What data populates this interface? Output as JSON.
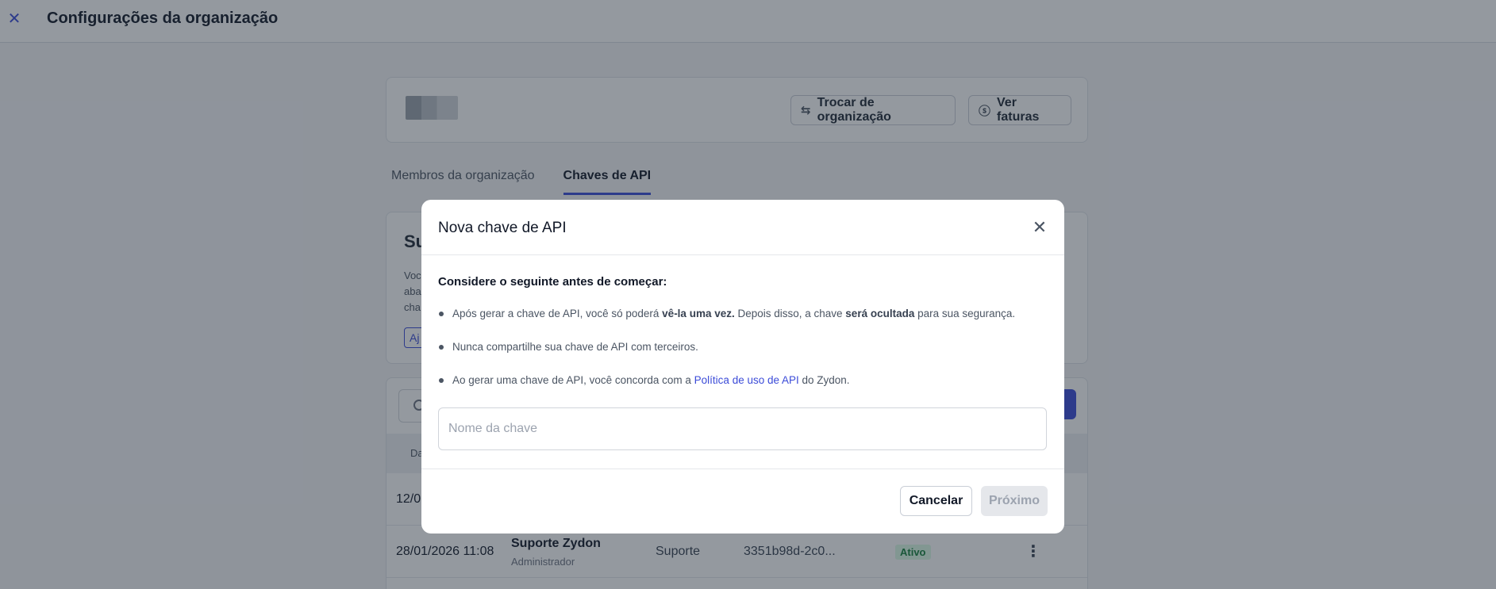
{
  "header": {
    "title": "Configurações da organização"
  },
  "org_card": {
    "switch_label": "Trocar de organização",
    "invoices_label": "Ver faturas"
  },
  "tabs": [
    {
      "label": "Membros da organização",
      "active": false
    },
    {
      "label": "Chaves de API",
      "active": true
    }
  ],
  "sub_card": {
    "title_partial": "Su",
    "text_partial": "Voc aba cha",
    "chip_partial": "Aj"
  },
  "table": {
    "header_partial": "Da",
    "rows": [
      {
        "date": "12/0",
        "name": "",
        "role": "",
        "type": "",
        "key": "",
        "status": ""
      },
      {
        "date": "28/01/2026 11:08",
        "name": "Suporte Zydon",
        "role": "Administrador",
        "type": "Suporte",
        "key": "3351b98d-2c0...",
        "status": "Ativo"
      }
    ]
  },
  "modal": {
    "title": "Nova chave de API",
    "lead": "Considere o seguinte antes de começar:",
    "bullet1": {
      "a": "Após gerar a chave de API, você só poderá ",
      "b": "vê-la uma vez.",
      "c": " Depois disso, a chave ",
      "d": "será ocultada",
      "e": " para sua segurança."
    },
    "bullet2": "Nunca compartilhe sua chave de API com terceiros.",
    "bullet3": {
      "a": "Ao gerar uma chave de API, você concorda com a ",
      "link": "Política de uso de API",
      "b": " do Zydon."
    },
    "input_placeholder": "Nome da chave",
    "input_value": "",
    "cancel_label": "Cancelar",
    "next_label": "Próximo"
  },
  "icons": {
    "close": "close-icon",
    "switch": "swap-arrows-icon",
    "invoices": "dollar-circle-icon",
    "search": "search-icon",
    "kebab": "kebab-menu-icon"
  },
  "colors": {
    "accent": "#3b4bd8",
    "status_active_bg": "#dcfce7",
    "status_active_text": "#15803d"
  }
}
